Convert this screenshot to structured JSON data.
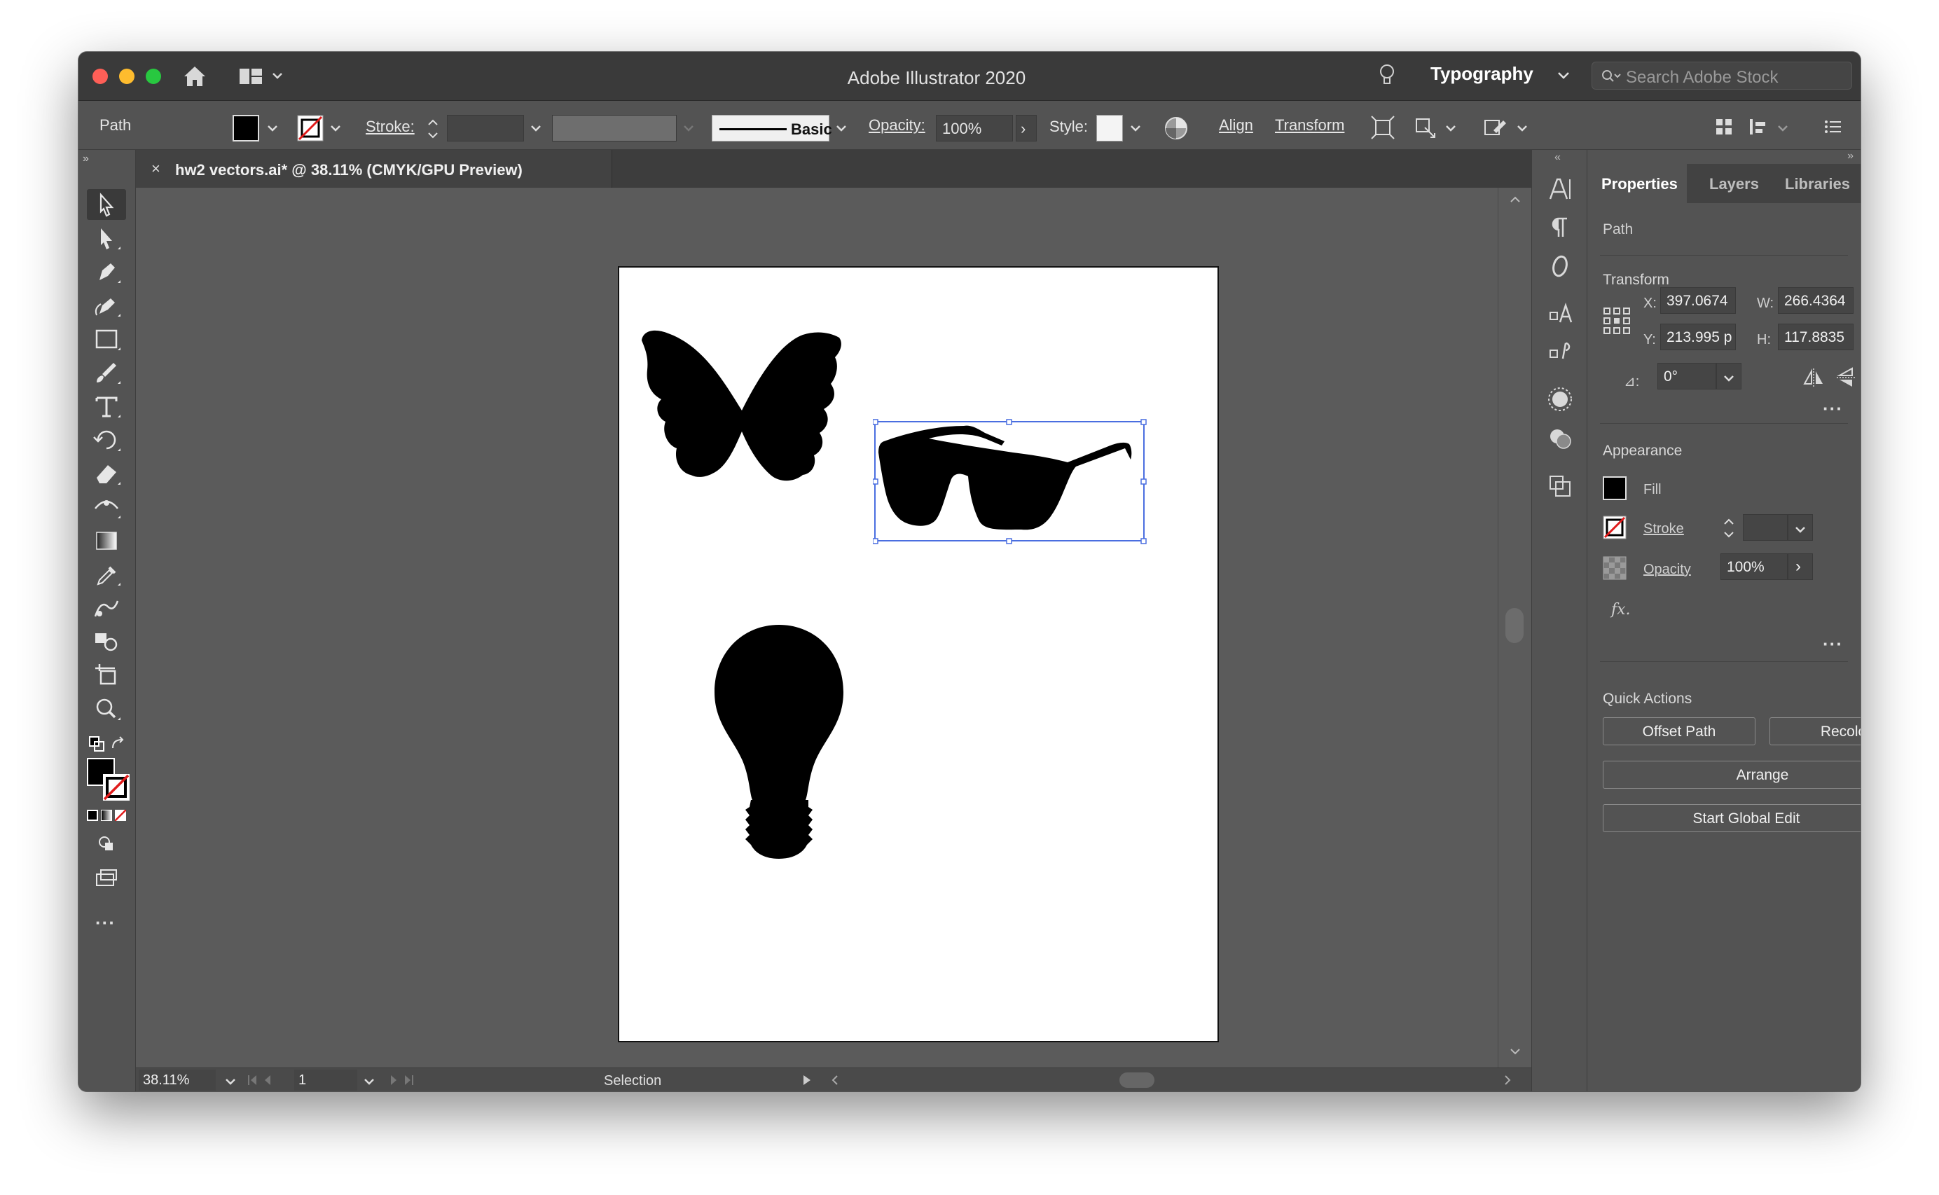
{
  "app": {
    "title": "Adobe Illustrator 2020",
    "workspace": "Typography",
    "stock_search_placeholder": "Search Adobe Stock"
  },
  "control_bar": {
    "selection_type": "Path",
    "stroke_label": "Stroke:",
    "stroke_weight": "",
    "brush_label": "Basic",
    "opacity_label": "Opacity:",
    "opacity_value": "100%",
    "style_label": "Style:",
    "align_label": "Align",
    "transform_label": "Transform"
  },
  "document": {
    "tab_title": "hw2 vectors.ai* @ 38.11% (CMYK/GPU Preview)",
    "close_glyph": "×"
  },
  "status_bar": {
    "zoom": "38.11%",
    "artboard_number": "1",
    "tool_mode": "Selection"
  },
  "properties_panel": {
    "tabs": [
      "Properties",
      "Layers",
      "Libraries"
    ],
    "active_tab": "Properties",
    "object_type": "Path",
    "transform": {
      "title": "Transform",
      "x_label": "X:",
      "x": "397.0674",
      "y_label": "Y:",
      "y": "213.995 p",
      "w_label": "W:",
      "w": "266.4364",
      "h_label": "H:",
      "h": "117.8835",
      "rotation_symbol": "⊿:",
      "rotation": "0°"
    },
    "appearance": {
      "title": "Appearance",
      "fill_label": "Fill",
      "stroke_label": "Stroke",
      "opacity_label": "Opacity",
      "opacity_value": "100%",
      "fx_label": "fx."
    },
    "quick_actions": {
      "title": "Quick Actions",
      "offset_path": "Offset Path",
      "recolor": "Recolor",
      "arrange": "Arrange",
      "start_global_edit": "Start Global Edit"
    }
  },
  "colors": {
    "fill": "#000000",
    "selection_bounds": "#4a6ee0",
    "ui_dark": "#535353"
  }
}
